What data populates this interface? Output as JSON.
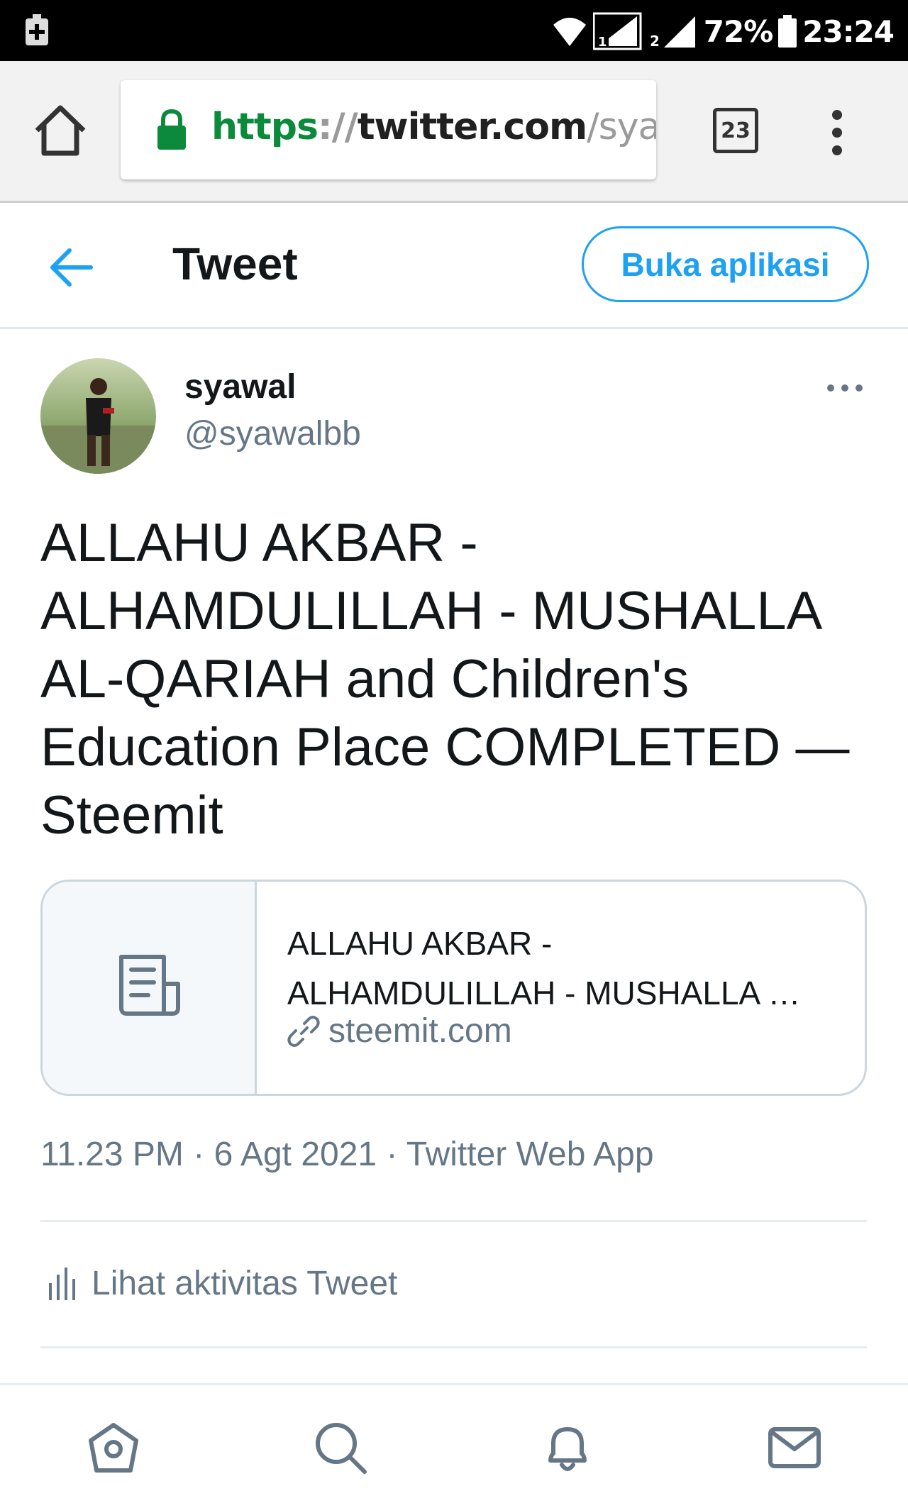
{
  "status_bar": {
    "battery_percent": "72%",
    "time": "23:24",
    "sim1": "1",
    "sim2": "2",
    "icons": [
      "add-notification-icon",
      "wifi-icon",
      "signal-icon",
      "battery-icon"
    ]
  },
  "browser": {
    "url_scheme": "https",
    "url_sep": "://",
    "url_host": "twitter.com",
    "url_path": "/syawc",
    "tab_count": "23",
    "icons": [
      "home-icon",
      "lock-icon",
      "menu-dots-icon"
    ]
  },
  "header": {
    "title": "Tweet",
    "open_app_label": "Buka aplikasi",
    "accent_color": "#1da1f2"
  },
  "tweet": {
    "author_name": "syawal",
    "author_handle": "@syawalbb",
    "text": "ALLAHU AKBAR - ALHAMDULILLAH - MUSHALLA AL-QARIAH and Children's Education Place COMPLETED — Steemit",
    "card": {
      "title_line1": "ALLAHU AKBAR -",
      "title_line2": "ALHAMDULILLAH - MUSHALLA …",
      "domain": "steemit.com"
    },
    "time": "11.23 PM",
    "date": "6 Agt 2021",
    "source": "Twitter Web App",
    "dot": "·",
    "activity_label": "Lihat aktivitas Tweet"
  },
  "bottom_nav": {
    "items": [
      "home-icon",
      "search-icon",
      "notifications-icon",
      "messages-icon"
    ]
  }
}
